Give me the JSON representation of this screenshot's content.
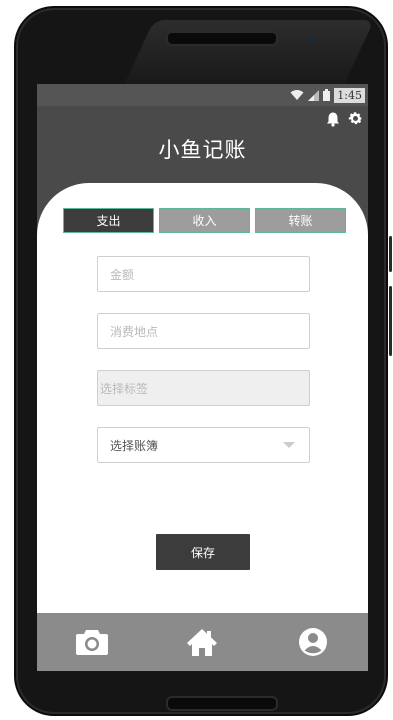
{
  "status_bar": {
    "time": "1:45"
  },
  "header": {
    "title": "小鱼记账"
  },
  "tabs": [
    {
      "label": "支出",
      "active": true
    },
    {
      "label": "收入",
      "active": false
    },
    {
      "label": "转账",
      "active": false
    }
  ],
  "form": {
    "amount_placeholder": "金额",
    "location_placeholder": "消费地点",
    "tag_placeholder": "选择标签",
    "account_book_value": "选择账簿"
  },
  "save_label": "保存",
  "bottom_nav": [
    "camera-icon",
    "home-icon",
    "user-icon"
  ],
  "colors": {
    "header_bg": "#4a4a4a",
    "active_tab": "#3c3c3c",
    "inactive_tab": "#9d9d9d",
    "tab_border": "#5bb89b",
    "bottom_nav_bg": "#8b8b8b"
  }
}
